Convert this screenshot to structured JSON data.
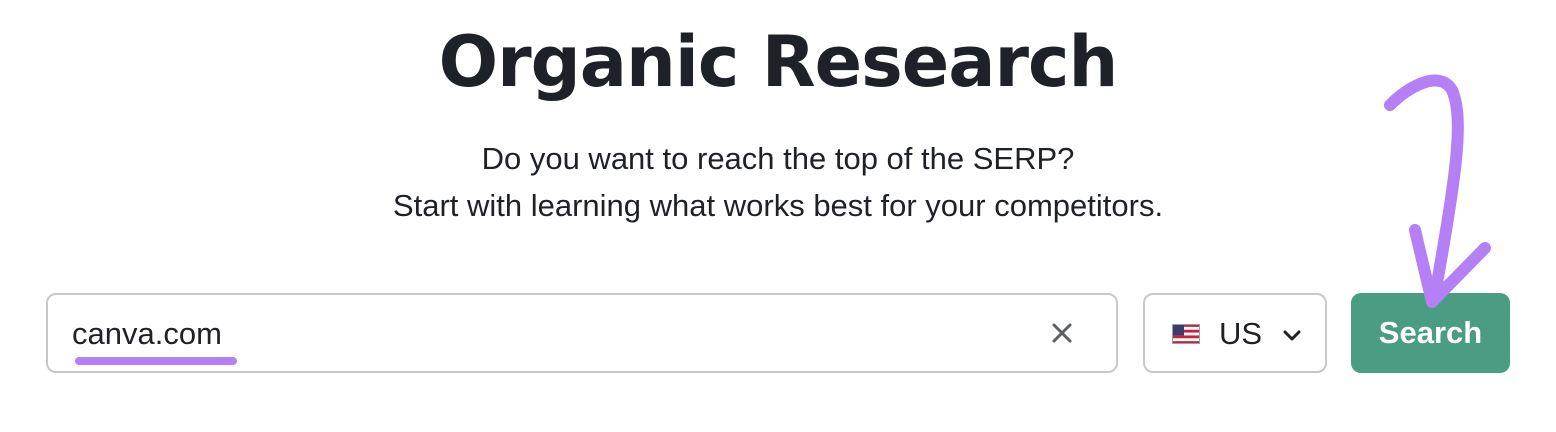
{
  "header": {
    "title": "Organic Research",
    "subtitle_line1": "Do you want to reach the top of the SERP?",
    "subtitle_line2": "Start with learning what works best for your competitors."
  },
  "search": {
    "value": "canva.com",
    "clear_icon": "close-icon"
  },
  "region": {
    "flag_icon": "us-flag-icon",
    "label": "US",
    "dropdown_icon": "chevron-down-icon"
  },
  "actions": {
    "search_label": "Search"
  },
  "colors": {
    "accent_purple": "#b57ff5",
    "button_green": "#4a9d82",
    "border_gray": "#c7c8cc",
    "text_dark": "#1f2128"
  }
}
